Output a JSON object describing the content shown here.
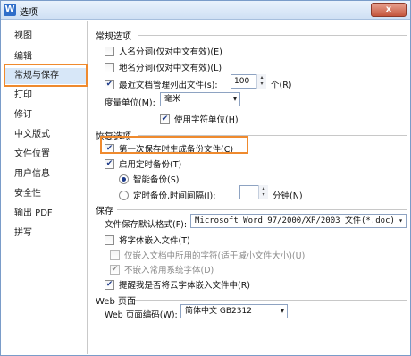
{
  "window": {
    "title": "选项",
    "app_icon": "W",
    "close_label": "x"
  },
  "sidebar": {
    "items": [
      {
        "label": "视图"
      },
      {
        "label": "编辑"
      },
      {
        "label": "常规与保存"
      },
      {
        "label": "打印"
      },
      {
        "label": "修订"
      },
      {
        "label": "中文版式"
      },
      {
        "label": "文件位置"
      },
      {
        "label": "用户信息"
      },
      {
        "label": "安全性"
      },
      {
        "label": "输出 PDF"
      },
      {
        "label": "拼写"
      }
    ],
    "active": "常规与保存"
  },
  "general": {
    "title": "常规选项",
    "name_segmentation": {
      "label": "人名分词(仅对中文有效)(E)",
      "checked": false
    },
    "place_segmentation": {
      "label": "地名分词(仅对中文有效)(L)",
      "checked": false
    },
    "recent_files": {
      "label": "最近文档管理列出文件(s):",
      "checked": true,
      "value": "100",
      "unit": "个(R)"
    },
    "unit_label": "度量单位(M):",
    "unit_value": "毫米",
    "char_unit": {
      "label": "使用字符单位(H)",
      "checked": true
    }
  },
  "backup": {
    "title": "恢复选项",
    "first_save_backup": {
      "label": "第一次保存时生成备份文件(C)",
      "checked": true
    },
    "timed_backup": {
      "label": "启用定时备份(T)",
      "checked": true
    },
    "smart_backup": {
      "label": "智能备份(S)",
      "selected": true
    },
    "interval_backup": {
      "label": "定时备份,时间间隔(I):",
      "selected": false,
      "value": "",
      "unit": "分钟(N)"
    }
  },
  "save": {
    "title": "保存",
    "format_label": "文件保存默认格式(F):",
    "format_value": "Microsoft Word 97/2000/XP/2003 文件(*.doc)",
    "embed_fonts": {
      "label": "将字体嵌入文件(T)",
      "checked": false
    },
    "embed_used_only": {
      "label": "仅嵌入文档中所用的字符(适于减小文件大小)(U)",
      "checked": false
    },
    "no_common_fonts": {
      "label": "不嵌入常用系统字体(D)",
      "checked": true
    },
    "remind_cloud_fonts": {
      "label": "提醒我是否将云字体嵌入文件中(R)",
      "checked": true
    }
  },
  "web": {
    "title": "Web 页面",
    "encoding_label": "Web 页面编码(W):",
    "encoding_value": "简体中文 GB2312"
  },
  "icons": {
    "check": "✔",
    "dropdown": "▾",
    "spin_up": "▴",
    "spin_down": "▾"
  }
}
